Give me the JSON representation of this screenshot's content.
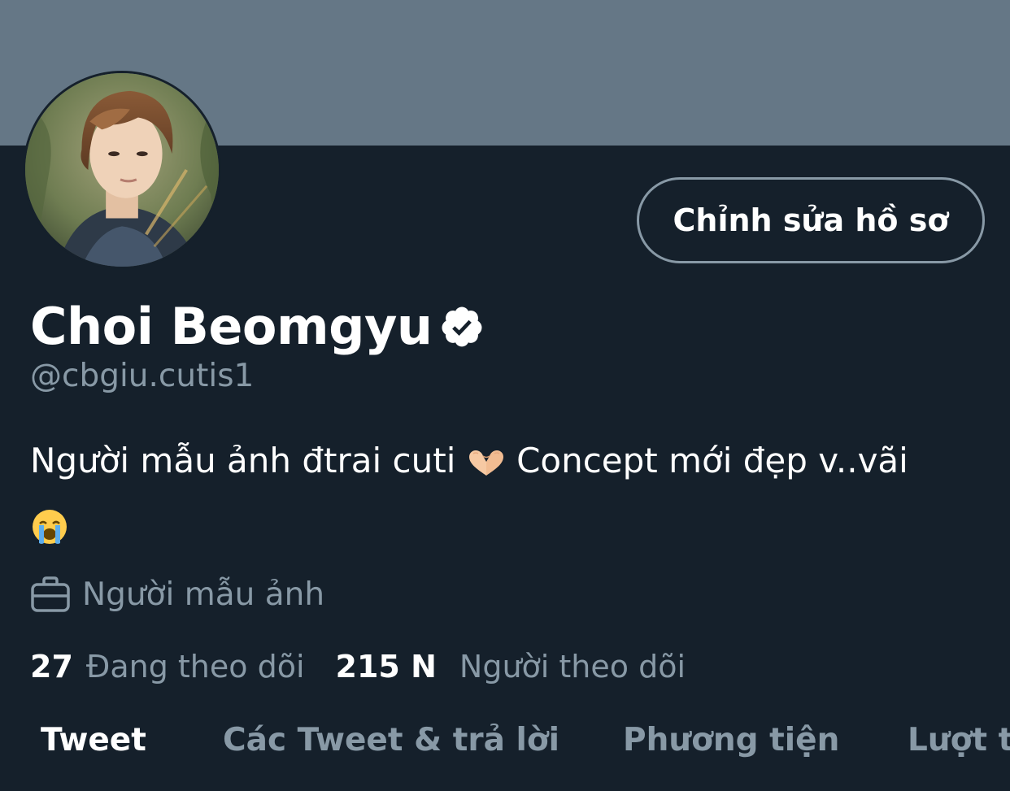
{
  "profile": {
    "edit_button_label": "Chỉnh sửa hồ sơ",
    "display_name": "Choi Beomgyu",
    "handle": "@cbgiu.cutis1",
    "bio_text": "Người mẫu ảnh đtrai cuti",
    "bio_text_2": "Concept mới đẹp v..vãi",
    "bio_emojis": [
      "heart-hands-emoji",
      "loudly-crying-face-emoji"
    ],
    "job": "Người mẫu ảnh",
    "verified": true
  },
  "stats": {
    "following_count": "27",
    "following_label": "Đang theo dõi",
    "followers_count": "215 N",
    "followers_label": "Người theo dõi"
  },
  "tabs": [
    {
      "label": "Tweet",
      "active": true
    },
    {
      "label": "Các Tweet & trả lời",
      "active": false
    },
    {
      "label": "Phương tiện",
      "active": false
    },
    {
      "label": "Lượt t",
      "active": false
    }
  ],
  "colors": {
    "background": "#15202b",
    "banner": "#657786",
    "secondary_text": "#8899a6",
    "primary_text": "#ffffff"
  }
}
